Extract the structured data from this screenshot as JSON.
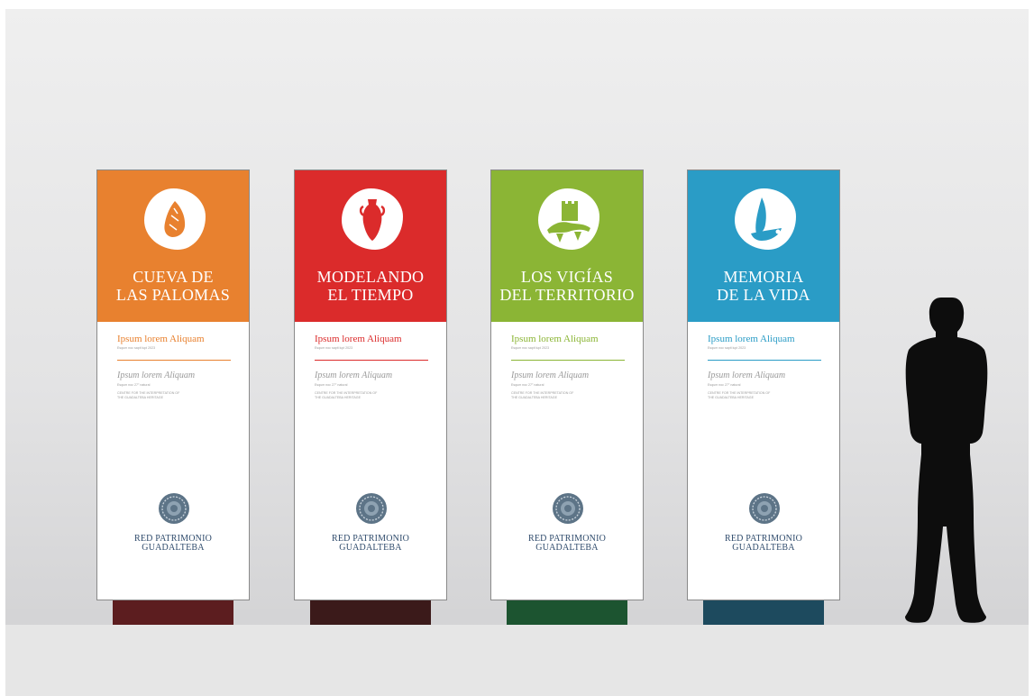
{
  "panels": [
    {
      "title_line1": "CUEVA DE",
      "title_line2": "LAS PALOMAS",
      "color": "#e8812f",
      "base_color": "#5c1d1f",
      "icon": "arrowhead-icon",
      "subtitle": "Ipsum lorem Aliquam",
      "subtitle_detail": "Esqum noc sapit lupi 2023",
      "second_title": "Ipsum lorem Aliquam",
      "second_detail": "Esqum noc 27° natural",
      "caption_line1": "CENTRE FOR THE INTERPRETATION OF",
      "caption_line2": "THE GUADALTEBA HERITAGE",
      "org_line1": "RED PATRIMONIO",
      "org_line2": "GUADALTEBA"
    },
    {
      "title_line1": "MODELANDO",
      "title_line2": "EL TIEMPO",
      "color": "#db2b2b",
      "base_color": "#3b1a1a",
      "icon": "amphora-icon",
      "subtitle": "Ipsum lorem Aliquam",
      "subtitle_detail": "Esqum noc sapit lupi 2023",
      "second_title": "Ipsum lorem Aliquam",
      "second_detail": "Esqum noc 27° natural",
      "caption_line1": "CENTRE FOR THE INTERPRETATION OF",
      "caption_line2": "THE GUADALTEBA HERITAGE",
      "org_line1": "RED PATRIMONIO",
      "org_line2": "GUADALTEBA"
    },
    {
      "title_line1": "LOS VIGÍAS",
      "title_line2": "DEL TERRITORIO",
      "color": "#8bb535",
      "base_color": "#1c5430",
      "icon": "castle-icon",
      "subtitle": "Ipsum lorem Aliquam",
      "subtitle_detail": "Esqum noc sapit lupi 2023",
      "second_title": "Ipsum lorem Aliquam",
      "second_detail": "Esqum noc 27° natural",
      "caption_line1": "CENTRE FOR THE INTERPRETATION OF",
      "caption_line2": "THE GUADALTEBA HERITAGE",
      "org_line1": "RED PATRIMONIO",
      "org_line2": "GUADALTEBA"
    },
    {
      "title_line1": "MEMORIA",
      "title_line2": "DE LA VIDA",
      "color": "#2a9cc6",
      "base_color": "#1d4a5e",
      "icon": "vessel-icon",
      "subtitle": "Ipsum lorem Aliquam",
      "subtitle_detail": "Esqum noc sapit lupi 2023",
      "second_title": "Ipsum lorem Aliquam",
      "second_detail": "Esqum noc 27° natural",
      "caption_line1": "CENTRE FOR THE INTERPRETATION OF",
      "caption_line2": "THE GUADALTEBA HERITAGE",
      "org_line1": "RED PATRIMONIO",
      "org_line2": "GUADALTEBA"
    }
  ],
  "figure": {
    "icon": "person-silhouette",
    "color": "#0d0d0d"
  }
}
